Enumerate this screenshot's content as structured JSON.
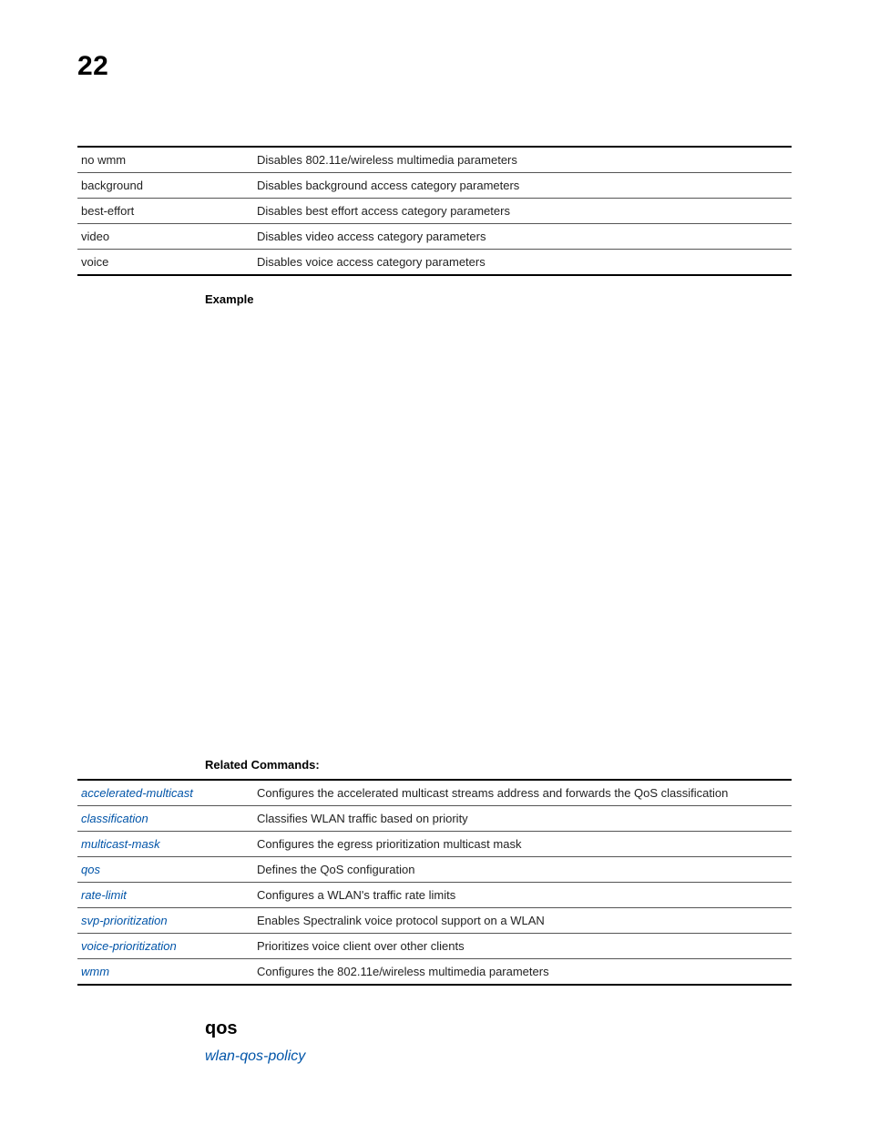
{
  "chapter": "22",
  "tables": {
    "params": [
      {
        "name": "no wmm",
        "desc": "Disables 802.11e/wireless multimedia parameters"
      },
      {
        "name": "background",
        "desc": "Disables background access category parameters"
      },
      {
        "name": "best-effort",
        "desc": "Disables best effort access category parameters"
      },
      {
        "name": "video",
        "desc": "Disables video access category parameters"
      },
      {
        "name": "voice",
        "desc": "Disables voice access category parameters"
      }
    ],
    "related": [
      {
        "name": "accelerated-multicast",
        "desc": "Configures the accelerated multicast streams address and forwards the QoS classification"
      },
      {
        "name": "classification",
        "desc": "Classifies WLAN traffic based on priority"
      },
      {
        "name": "multicast-mask",
        "desc": "Configures the egress prioritization multicast mask"
      },
      {
        "name": "qos",
        "desc": "Defines the QoS configuration"
      },
      {
        "name": "rate-limit",
        "desc": "Configures a WLAN's traffic rate limits"
      },
      {
        "name": "svp-prioritization",
        "desc": "Enables Spectralink voice protocol support on a WLAN"
      },
      {
        "name": "voice-prioritization",
        "desc": "Prioritizes voice client over other clients"
      },
      {
        "name": "wmm",
        "desc": "Configures the 802.11e/wireless multimedia parameters"
      }
    ]
  },
  "labels": {
    "example": "Example",
    "related": "Related Commands:"
  },
  "qos": {
    "heading": "qos",
    "link": "wlan-qos-policy"
  }
}
